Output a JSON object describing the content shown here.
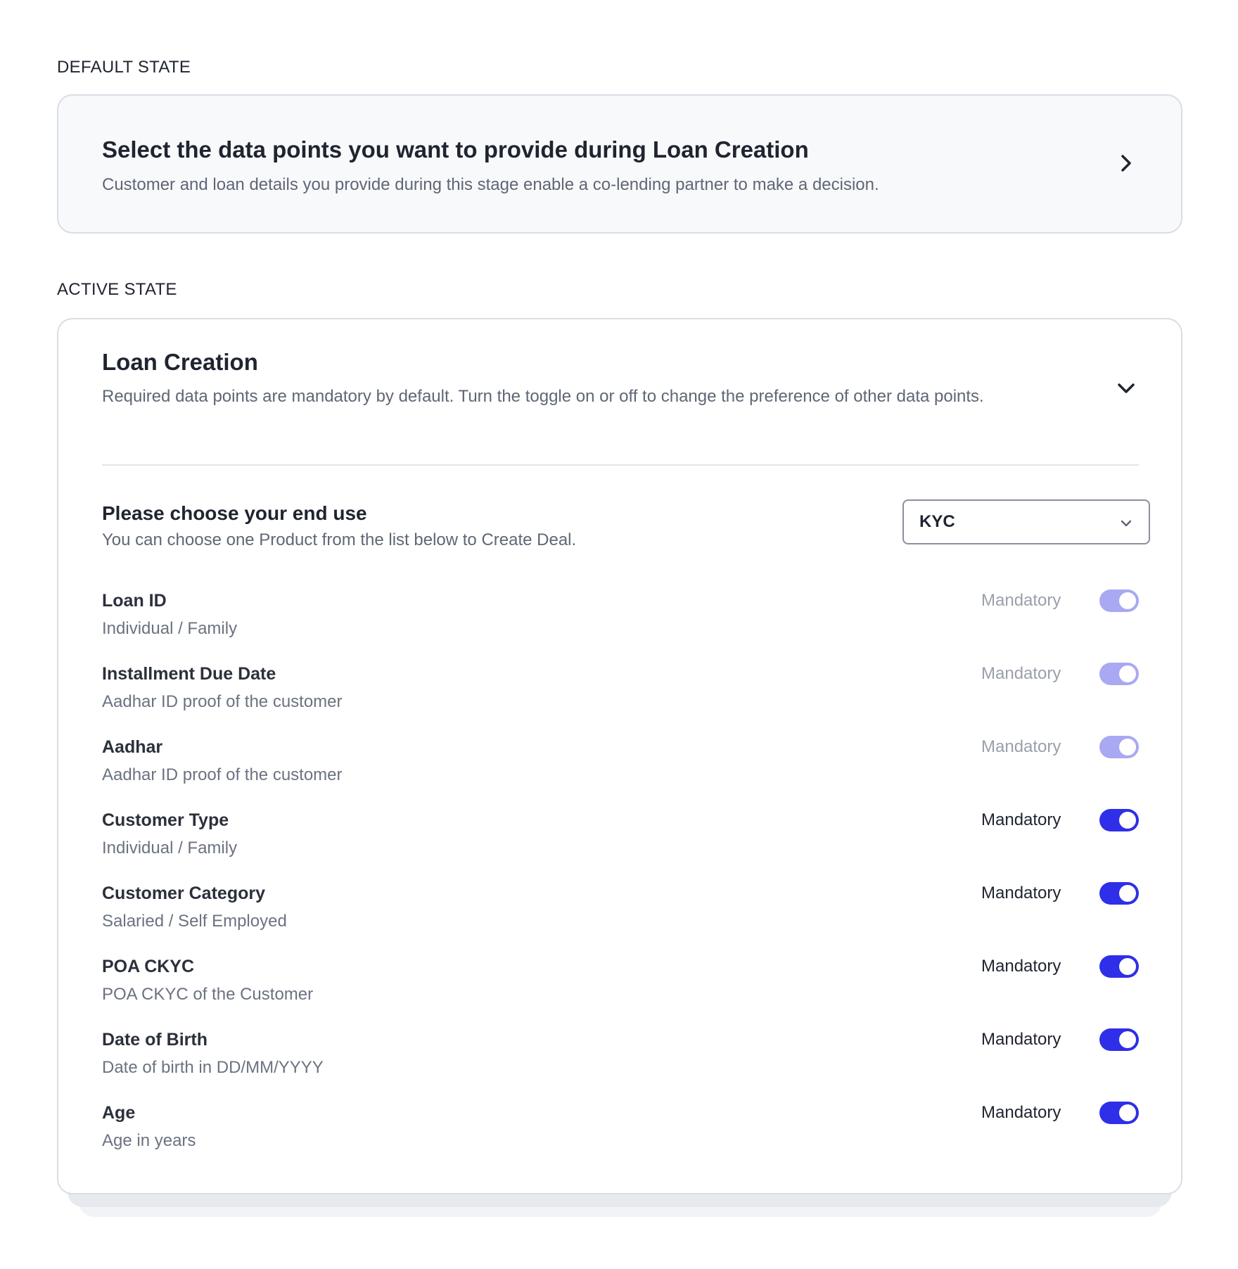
{
  "default_section": {
    "label": "DEFAULT STATE",
    "card": {
      "title": "Select the data points you want to provide during Loan Creation",
      "subtitle": "Customer and loan details you provide during this stage enable a co-lending partner to make a decision.",
      "icon": "chevron-right-icon"
    }
  },
  "active_section": {
    "label": "ACTIVE STATE",
    "card": {
      "title": "Loan Creation",
      "description": "Required data points are mandatory by default. Turn the toggle on or off to change the preference of other data points.",
      "icon": "chevron-down-icon",
      "end_use": {
        "title": "Please choose your end use",
        "description": "You can choose one Product from the list below to Create Deal.",
        "selected": "KYC"
      },
      "rows": [
        {
          "name": "Loan ID",
          "sub": "Individual / Family",
          "status": "Mandatory",
          "enabled": false,
          "on": true
        },
        {
          "name": "Installment Due Date",
          "sub": "Aadhar ID proof of the customer",
          "status": "Mandatory",
          "enabled": false,
          "on": true
        },
        {
          "name": "Aadhar",
          "sub": "Aadhar ID proof of the customer",
          "status": "Mandatory",
          "enabled": false,
          "on": true
        },
        {
          "name": "Customer Type",
          "sub": "Individual / Family",
          "status": "Mandatory",
          "enabled": true,
          "on": true
        },
        {
          "name": "Customer Category",
          "sub": "Salaried / Self Employed",
          "status": "Mandatory",
          "enabled": true,
          "on": true
        },
        {
          "name": "POA CKYC",
          "sub": "POA CKYC of the Customer",
          "status": "Mandatory",
          "enabled": true,
          "on": true
        },
        {
          "name": "Date of Birth",
          "sub": "Date of birth in DD/MM/YYYY",
          "status": "Mandatory",
          "enabled": true,
          "on": true
        },
        {
          "name": "Age",
          "sub": "Age in years",
          "status": "Mandatory",
          "enabled": true,
          "on": true
        }
      ]
    }
  },
  "colors": {
    "toggle_on": "#2f2ee8",
    "toggle_disabled": "#a9a8f2"
  }
}
